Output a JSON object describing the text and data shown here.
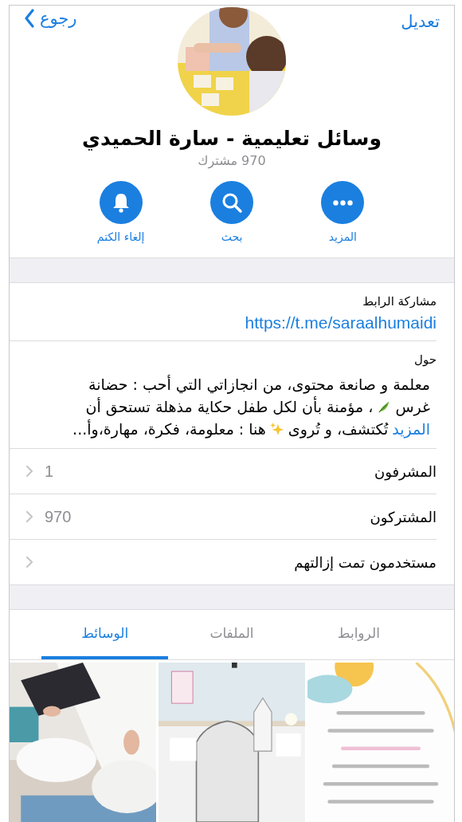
{
  "nav": {
    "edit": "تعديل",
    "back": "رجوع"
  },
  "title": "وسائل تعليمية - سارة الحميدي",
  "subtitle": "970 مشترك",
  "actions": [
    {
      "kind": "more",
      "label": "المزيد"
    },
    {
      "kind": "search",
      "label": "بحث"
    },
    {
      "kind": "unmute",
      "label": "إلغاء الكتم"
    }
  ],
  "share": {
    "label": "مشاركة الرابط",
    "link": "https://t.me/saraalhumaidi"
  },
  "about": {
    "label": "حول",
    "part_1": "معلمة و صانعة محتوى، من انجازاتي التي أحب : حضانة",
    "part_1b": "غرس",
    "part_2": "، مؤمنة بأن لكل طفل حكاية مذهلة تستحق أن",
    "more": "المزيد",
    "part_3": "تُكتشف، و تُروى",
    "part_4": "هنا : معلومة، فكرة، مهارة،وأ..."
  },
  "rows": [
    {
      "label": "المشرفون",
      "value": "1"
    },
    {
      "label": "المشتركون",
      "value": "970"
    },
    {
      "label": "مستخدمون تمت إزالتهم"
    }
  ],
  "tabs": [
    {
      "label": "الروابط",
      "selected": false
    },
    {
      "label": "الملفات",
      "selected": false
    },
    {
      "label": "الوسائط",
      "selected": true
    }
  ]
}
